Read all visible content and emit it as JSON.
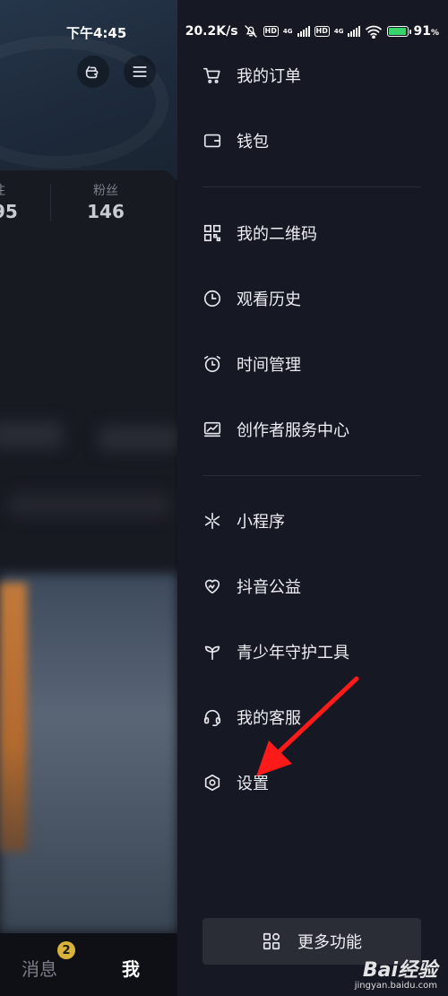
{
  "status_bar": {
    "time": "下午4:45",
    "net_speed": "20.2K/s",
    "battery": "91",
    "battery_unit": "%",
    "hd": "HD",
    "sim_label": "4G"
  },
  "profile": {
    "stats": [
      {
        "label": "注",
        "value": "95"
      },
      {
        "label": "粉丝",
        "value": "146"
      }
    ],
    "tabbar": {
      "messages": "消息",
      "messages_badge": "2",
      "me": "我"
    }
  },
  "drawer": {
    "sections": [
      [
        {
          "label": "我的订单",
          "icon": "cart-icon"
        },
        {
          "label": "钱包",
          "icon": "wallet-icon"
        }
      ],
      [
        {
          "label": "我的二维码",
          "icon": "qrcode-icon"
        },
        {
          "label": "观看历史",
          "icon": "clock-icon"
        },
        {
          "label": "时间管理",
          "icon": "alarm-icon"
        },
        {
          "label": "创作者服务中心",
          "icon": "chart-icon"
        }
      ],
      [
        {
          "label": "小程序",
          "icon": "asterisk-icon"
        },
        {
          "label": "抖音公益",
          "icon": "heart-icon"
        },
        {
          "label": "青少年守护工具",
          "icon": "sprout-icon"
        },
        {
          "label": "我的客服",
          "icon": "headset-icon"
        },
        {
          "label": "设置",
          "icon": "settings-icon"
        }
      ]
    ],
    "more_button": "更多功能"
  },
  "watermark": {
    "brand": "Bai经验",
    "url": "jingyan.baidu.com"
  },
  "colors": {
    "drawer_bg": "#161823",
    "arrow": "#ff1a1a",
    "badge": "#d8b23a"
  }
}
